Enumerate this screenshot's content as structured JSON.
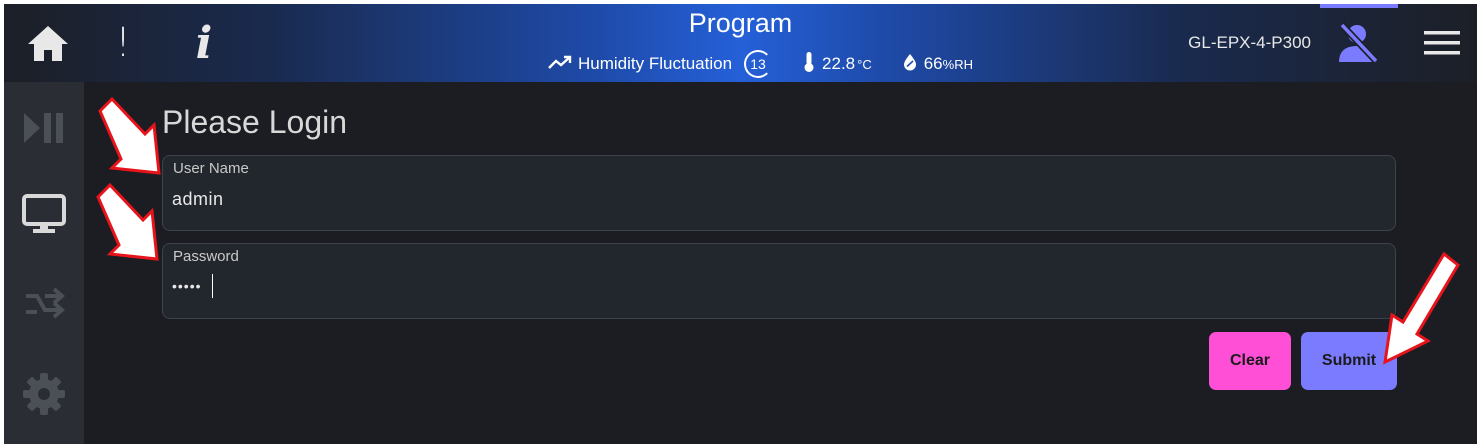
{
  "header": {
    "title": "Program",
    "status": {
      "program_name": "Humidity Fluctuation",
      "cycle_count": "13",
      "temperature_value": "22.8",
      "temperature_unit": "°C",
      "humidity_value": "66",
      "humidity_unit": "%RH"
    },
    "device_name": "GL-EPX-4-P300",
    "alert_glyph": "!",
    "info_glyph": "i"
  },
  "icons": {
    "home": "home-icon",
    "alert": "alert-icon",
    "info": "info-icon",
    "trend": "trend-up-icon",
    "thermometer": "thermometer-icon",
    "droplet": "droplet-icon",
    "user": "user-logged-out-icon",
    "menu": "hamburger-menu-icon",
    "play_pause": "play-pause-icon",
    "monitor": "monitor-icon",
    "shuffle": "transfer-icon",
    "settings": "gear-icon"
  },
  "login": {
    "title": "Please Login",
    "username_label": "User Name",
    "username_value": "admin",
    "password_label": "Password",
    "password_value": "•••••",
    "clear_label": "Clear",
    "submit_label": "Submit"
  },
  "colors": {
    "accent": "#7b7bff",
    "clear": "#ff4fd6",
    "background": "#1b1d22",
    "sidebar": "#2a2d33",
    "annotation_arrow": "#e8141b"
  }
}
